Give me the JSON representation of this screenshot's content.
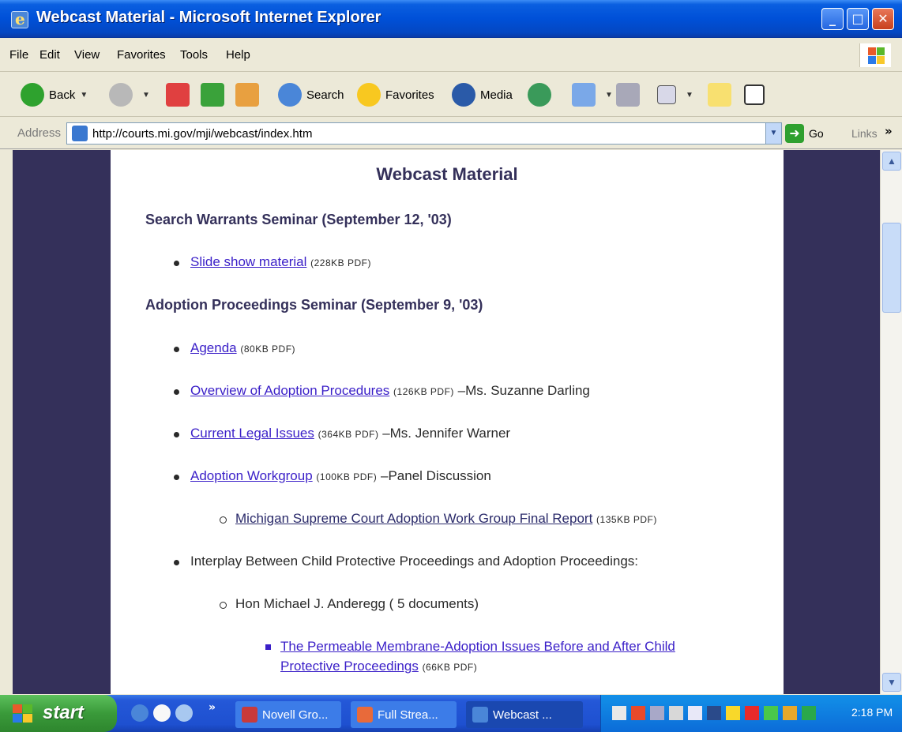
{
  "window": {
    "title": "Webcast Material - Microsoft Internet Explorer",
    "minimize": "_",
    "maximize": "□",
    "close": "✕"
  },
  "menu": [
    "File",
    "Edit",
    "View",
    "Favorites",
    "Tools",
    "Help"
  ],
  "toolbar": {
    "back": "Back",
    "search": "Search",
    "favorites": "Favorites",
    "media": "Media"
  },
  "address": {
    "label": "Address",
    "url": "http://courts.mi.gov/mji/webcast/index.htm",
    "go": "Go",
    "links": "Links",
    "more": "»"
  },
  "page": {
    "title": "Webcast Material",
    "sections": [
      {
        "heading": "Search Warrants Seminar (September 12, '03)",
        "items": [
          {
            "link": "Slide show material",
            "size": "(228KB PDF)",
            "suffix": ""
          }
        ]
      },
      {
        "heading": "Adoption Proceedings Seminar (September 9, '03)",
        "items": [
          {
            "link": "Agenda",
            "size": "(80KB PDF)",
            "suffix": ""
          },
          {
            "link": "Overview of Adoption Procedures",
            "size": "(126KB PDF)",
            "suffix": " –Ms. Suzanne Darling"
          },
          {
            "link": "Current Legal Issues",
            "size": "(364KB PDF)",
            "suffix": " –Ms. Jennifer Warner"
          },
          {
            "link": "Adoption Workgroup",
            "size": "(100KB PDF)",
            "suffix": " –Panel Discussion"
          }
        ],
        "subitem": {
          "link": "Michigan Supreme Court Adoption Work Group Final Report",
          "size": "(135KB PDF)"
        },
        "interplay": "Interplay Between Child Protective Proceedings and Adoption Proceedings:",
        "speaker": "Hon Michael J. Anderegg ( 5 documents)",
        "doc": {
          "link_line1": "The Permeable Membrane-Adoption Issues Before and After Child",
          "link_line2": "Protective Proceedings",
          "size": "(66KB PDF)"
        }
      }
    ]
  },
  "taskbar": {
    "start": "start",
    "more": "»",
    "tasks": [
      "Novell Gro...",
      "Full Strea...",
      "Webcast ..."
    ],
    "clock": "2:18 PM"
  },
  "colors": {
    "page_bg": "#34305A",
    "heading": "#34305A",
    "link": "#3A1FC8"
  }
}
